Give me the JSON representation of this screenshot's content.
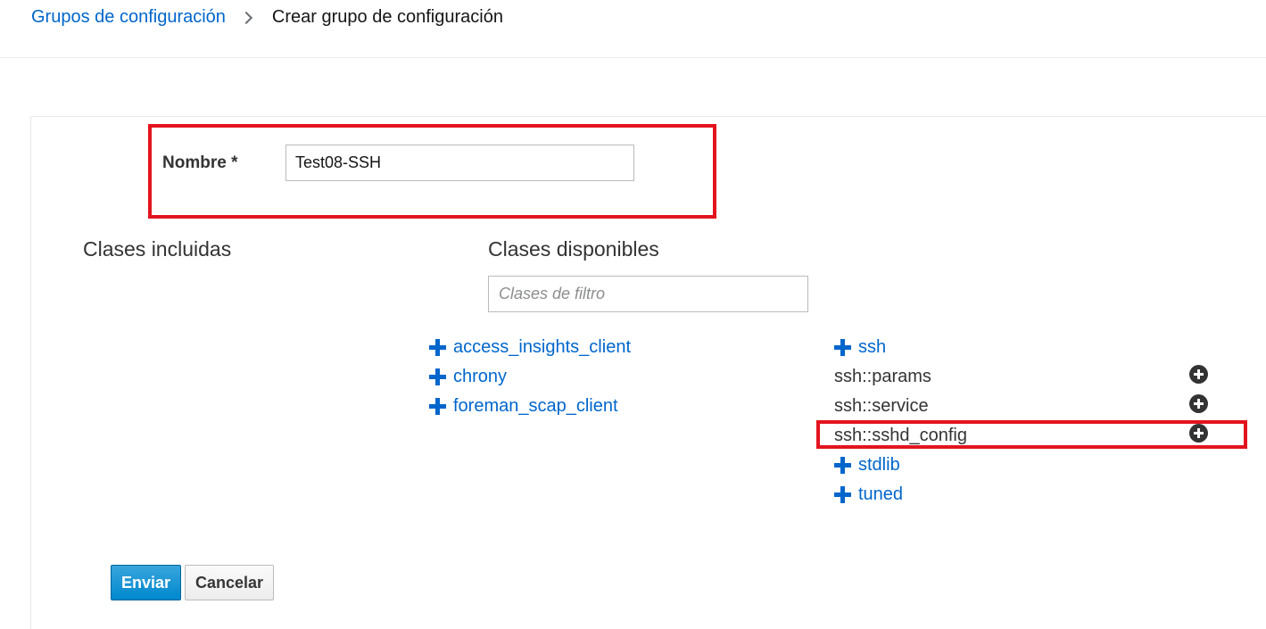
{
  "breadcrumb": {
    "parent": "Grupos de configuración",
    "current": "Crear grupo de configuración"
  },
  "form": {
    "name_label": "Nombre *",
    "name_value": "Test08-SSH"
  },
  "included_classes": {
    "title": "Clases incluidas"
  },
  "available_classes": {
    "title": "Clases disponibles",
    "filter_placeholder": "Clases de filtro",
    "left_column": [
      {
        "label": "access_insights_client",
        "icon": "plus-icon"
      },
      {
        "label": "chrony",
        "icon": "plus-icon"
      },
      {
        "label": "foreman_scap_client",
        "icon": "plus-icon"
      }
    ],
    "right_column": [
      {
        "label": "ssh",
        "icon": "plus-icon",
        "expanded": true
      },
      {
        "label": "ssh::params",
        "icon": "circle-plus-icon"
      },
      {
        "label": "ssh::service",
        "icon": "circle-plus-icon"
      },
      {
        "label": "ssh::sshd_config",
        "icon": "circle-plus-icon",
        "highlighted": true
      },
      {
        "label": "stdlib",
        "icon": "plus-icon"
      },
      {
        "label": "tuned",
        "icon": "plus-icon"
      }
    ]
  },
  "buttons": {
    "submit": "Enviar",
    "cancel": "Cancelar"
  },
  "colors": {
    "link": "#0066cc",
    "highlight": "#e3141e",
    "primary_button": "#0088ce"
  }
}
